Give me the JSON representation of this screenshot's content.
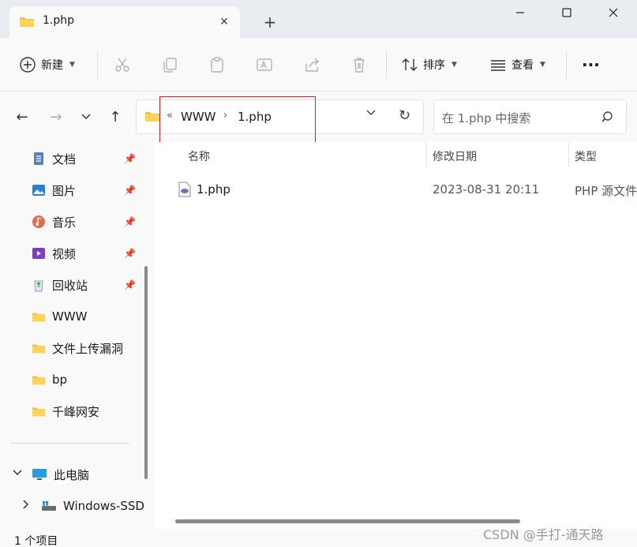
{
  "tab": {
    "title": "1.php",
    "close": "✕",
    "new_tab": "+"
  },
  "window_controls": {
    "minimize": "minimize",
    "maximize": "maximize",
    "close": "close"
  },
  "toolbar": {
    "new_label": "新建",
    "sort_label": "排序",
    "view_label": "查看",
    "more_label": "···"
  },
  "nav": {
    "back": "←",
    "forward": "→",
    "recent": "⌄",
    "up": "↑"
  },
  "address": {
    "overflow": "«",
    "crumbs": [
      "WWW",
      "1.php"
    ],
    "separator": "›",
    "dropdown": "⌵",
    "refresh": "↻"
  },
  "search": {
    "placeholder": "在 1.php 中搜索"
  },
  "sidebar": {
    "quick": [
      {
        "label": "文档",
        "icon": "documents-icon",
        "pinned": true
      },
      {
        "label": "图片",
        "icon": "pictures-icon",
        "pinned": true
      },
      {
        "label": "音乐",
        "icon": "music-icon",
        "pinned": true
      },
      {
        "label": "视频",
        "icon": "videos-icon",
        "pinned": true
      },
      {
        "label": "回收站",
        "icon": "recycle-bin-icon",
        "pinned": true
      },
      {
        "label": "WWW",
        "icon": "folder-icon",
        "pinned": false
      },
      {
        "label": "文件上传漏洞",
        "icon": "folder-icon",
        "pinned": false
      },
      {
        "label": "bp",
        "icon": "folder-icon",
        "pinned": false
      },
      {
        "label": "千峰网安",
        "icon": "folder-icon",
        "pinned": false
      }
    ],
    "this_pc": "此电脑",
    "drive": "Windows-SSD"
  },
  "columns": {
    "name": "名称",
    "modified": "修改日期",
    "type": "类型"
  },
  "files": [
    {
      "name": "1.php",
      "modified": "2023-08-31 20:11",
      "type": "PHP 源文件"
    }
  ],
  "status": {
    "count": "1 个项目"
  },
  "watermark": "CSDN @手打-通天路",
  "colors": {
    "folder": "#f5c242",
    "highlight": "#d21f25",
    "accent": "#0067c0"
  }
}
